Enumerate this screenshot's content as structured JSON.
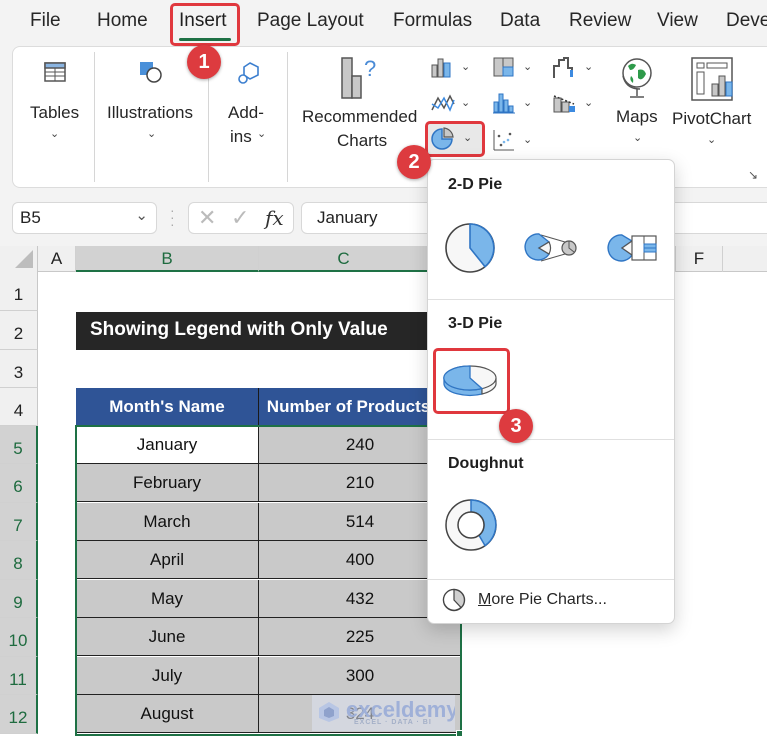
{
  "menu": {
    "tabs": [
      "File",
      "Home",
      "Insert",
      "Page Layout",
      "Formulas",
      "Data",
      "Review",
      "View",
      "Deve"
    ],
    "active": "Insert"
  },
  "ribbon": {
    "tables": "Tables",
    "illustrations": "Illustrations",
    "addins_line1": "Add-",
    "addins_line2": "ins",
    "recommended_line1": "Recommended",
    "recommended_line2": "Charts",
    "maps": "Maps",
    "pivotchart": "PivotChart"
  },
  "formula_bar": {
    "name_box": "B5",
    "formula_value": "January",
    "fx_label": "fx"
  },
  "grid": {
    "columns": [
      "A",
      "B",
      "C",
      "F"
    ],
    "rows": [
      "1",
      "2",
      "3",
      "4",
      "5",
      "6",
      "7",
      "8",
      "9",
      "10",
      "11",
      "12"
    ],
    "title": "Showing Legend with Only Value",
    "headers": [
      "Month's Name",
      "Number of Products"
    ],
    "data": [
      [
        "January",
        "240"
      ],
      [
        "February",
        "210"
      ],
      [
        "March",
        "514"
      ],
      [
        "April",
        "400"
      ],
      [
        "May",
        "432"
      ],
      [
        "June",
        "225"
      ],
      [
        "July",
        "300"
      ],
      [
        "August",
        "324"
      ]
    ]
  },
  "dropdown": {
    "sections": [
      "2-D Pie",
      "3-D Pie",
      "Doughnut"
    ],
    "more_label_underlined": "M",
    "more_label_rest": "ore Pie Charts..."
  },
  "badges": [
    "1",
    "2",
    "3"
  ],
  "watermark": {
    "name": "exceldemy",
    "tagline": "EXCEL · DATA · BI"
  },
  "colors": {
    "accent_green": "#1e7145",
    "highlight_red": "#e0383e",
    "header_blue": "#2f5496",
    "chart_blue": "#7ab6ea"
  }
}
